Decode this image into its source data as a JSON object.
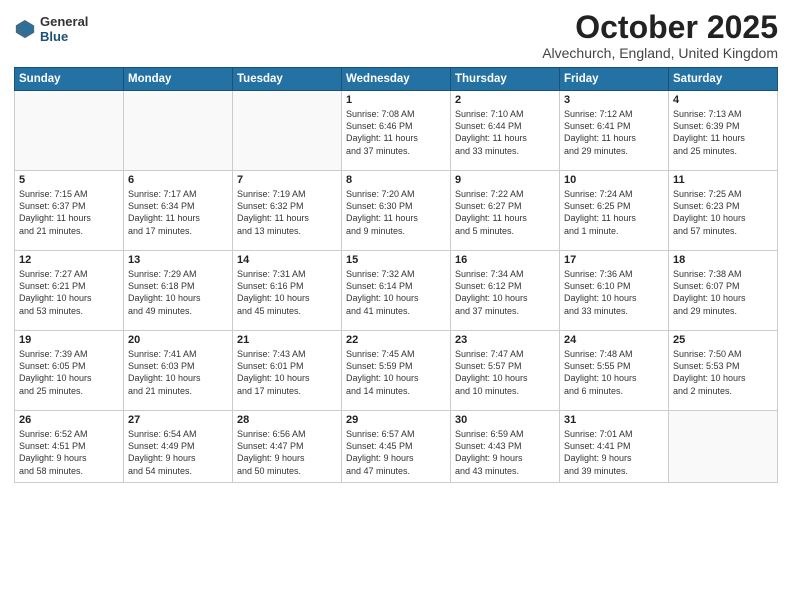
{
  "header": {
    "logo_general": "General",
    "logo_blue": "Blue",
    "month_title": "October 2025",
    "location": "Alvechurch, England, United Kingdom"
  },
  "weekdays": [
    "Sunday",
    "Monday",
    "Tuesday",
    "Wednesday",
    "Thursday",
    "Friday",
    "Saturday"
  ],
  "weeks": [
    [
      {
        "day": "",
        "text": ""
      },
      {
        "day": "",
        "text": ""
      },
      {
        "day": "",
        "text": ""
      },
      {
        "day": "1",
        "text": "Sunrise: 7:08 AM\nSunset: 6:46 PM\nDaylight: 11 hours\nand 37 minutes."
      },
      {
        "day": "2",
        "text": "Sunrise: 7:10 AM\nSunset: 6:44 PM\nDaylight: 11 hours\nand 33 minutes."
      },
      {
        "day": "3",
        "text": "Sunrise: 7:12 AM\nSunset: 6:41 PM\nDaylight: 11 hours\nand 29 minutes."
      },
      {
        "day": "4",
        "text": "Sunrise: 7:13 AM\nSunset: 6:39 PM\nDaylight: 11 hours\nand 25 minutes."
      }
    ],
    [
      {
        "day": "5",
        "text": "Sunrise: 7:15 AM\nSunset: 6:37 PM\nDaylight: 11 hours\nand 21 minutes."
      },
      {
        "day": "6",
        "text": "Sunrise: 7:17 AM\nSunset: 6:34 PM\nDaylight: 11 hours\nand 17 minutes."
      },
      {
        "day": "7",
        "text": "Sunrise: 7:19 AM\nSunset: 6:32 PM\nDaylight: 11 hours\nand 13 minutes."
      },
      {
        "day": "8",
        "text": "Sunrise: 7:20 AM\nSunset: 6:30 PM\nDaylight: 11 hours\nand 9 minutes."
      },
      {
        "day": "9",
        "text": "Sunrise: 7:22 AM\nSunset: 6:27 PM\nDaylight: 11 hours\nand 5 minutes."
      },
      {
        "day": "10",
        "text": "Sunrise: 7:24 AM\nSunset: 6:25 PM\nDaylight: 11 hours\nand 1 minute."
      },
      {
        "day": "11",
        "text": "Sunrise: 7:25 AM\nSunset: 6:23 PM\nDaylight: 10 hours\nand 57 minutes."
      }
    ],
    [
      {
        "day": "12",
        "text": "Sunrise: 7:27 AM\nSunset: 6:21 PM\nDaylight: 10 hours\nand 53 minutes."
      },
      {
        "day": "13",
        "text": "Sunrise: 7:29 AM\nSunset: 6:18 PM\nDaylight: 10 hours\nand 49 minutes."
      },
      {
        "day": "14",
        "text": "Sunrise: 7:31 AM\nSunset: 6:16 PM\nDaylight: 10 hours\nand 45 minutes."
      },
      {
        "day": "15",
        "text": "Sunrise: 7:32 AM\nSunset: 6:14 PM\nDaylight: 10 hours\nand 41 minutes."
      },
      {
        "day": "16",
        "text": "Sunrise: 7:34 AM\nSunset: 6:12 PM\nDaylight: 10 hours\nand 37 minutes."
      },
      {
        "day": "17",
        "text": "Sunrise: 7:36 AM\nSunset: 6:10 PM\nDaylight: 10 hours\nand 33 minutes."
      },
      {
        "day": "18",
        "text": "Sunrise: 7:38 AM\nSunset: 6:07 PM\nDaylight: 10 hours\nand 29 minutes."
      }
    ],
    [
      {
        "day": "19",
        "text": "Sunrise: 7:39 AM\nSunset: 6:05 PM\nDaylight: 10 hours\nand 25 minutes."
      },
      {
        "day": "20",
        "text": "Sunrise: 7:41 AM\nSunset: 6:03 PM\nDaylight: 10 hours\nand 21 minutes."
      },
      {
        "day": "21",
        "text": "Sunrise: 7:43 AM\nSunset: 6:01 PM\nDaylight: 10 hours\nand 17 minutes."
      },
      {
        "day": "22",
        "text": "Sunrise: 7:45 AM\nSunset: 5:59 PM\nDaylight: 10 hours\nand 14 minutes."
      },
      {
        "day": "23",
        "text": "Sunrise: 7:47 AM\nSunset: 5:57 PM\nDaylight: 10 hours\nand 10 minutes."
      },
      {
        "day": "24",
        "text": "Sunrise: 7:48 AM\nSunset: 5:55 PM\nDaylight: 10 hours\nand 6 minutes."
      },
      {
        "day": "25",
        "text": "Sunrise: 7:50 AM\nSunset: 5:53 PM\nDaylight: 10 hours\nand 2 minutes."
      }
    ],
    [
      {
        "day": "26",
        "text": "Sunrise: 6:52 AM\nSunset: 4:51 PM\nDaylight: 9 hours\nand 58 minutes."
      },
      {
        "day": "27",
        "text": "Sunrise: 6:54 AM\nSunset: 4:49 PM\nDaylight: 9 hours\nand 54 minutes."
      },
      {
        "day": "28",
        "text": "Sunrise: 6:56 AM\nSunset: 4:47 PM\nDaylight: 9 hours\nand 50 minutes."
      },
      {
        "day": "29",
        "text": "Sunrise: 6:57 AM\nSunset: 4:45 PM\nDaylight: 9 hours\nand 47 minutes."
      },
      {
        "day": "30",
        "text": "Sunrise: 6:59 AM\nSunset: 4:43 PM\nDaylight: 9 hours\nand 43 minutes."
      },
      {
        "day": "31",
        "text": "Sunrise: 7:01 AM\nSunset: 4:41 PM\nDaylight: 9 hours\nand 39 minutes."
      },
      {
        "day": "",
        "text": ""
      }
    ]
  ]
}
